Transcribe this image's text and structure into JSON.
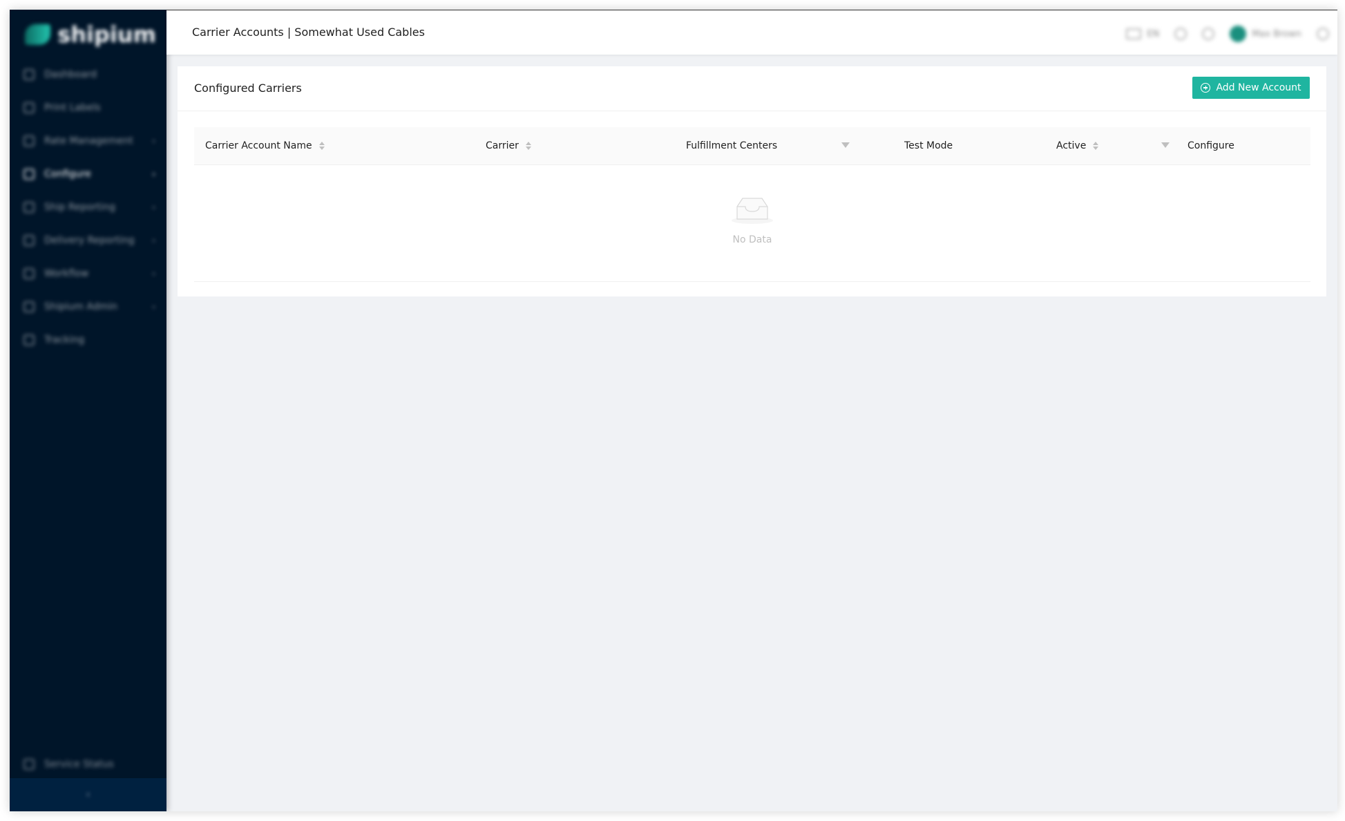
{
  "sidebar": {
    "logo_text": "shipium",
    "items": [
      {
        "label": "Dashboard",
        "icon": "dashboard-icon",
        "caret": ""
      },
      {
        "label": "Print Labels",
        "icon": "printer-icon",
        "caret": ""
      },
      {
        "label": "Rate Management",
        "icon": "tag-icon",
        "caret": "›"
      },
      {
        "label": "Configure",
        "icon": "settings-icon",
        "caret": "›"
      },
      {
        "label": "Ship Reporting",
        "icon": "report-icon",
        "caret": "›"
      },
      {
        "label": "Delivery Reporting",
        "icon": "chart-icon",
        "caret": "›"
      },
      {
        "label": "Workflow",
        "icon": "workflow-icon",
        "caret": "›"
      },
      {
        "label": "Shipium Admin",
        "icon": "admin-icon",
        "caret": "›"
      },
      {
        "label": "Tracking",
        "icon": "tracking-icon",
        "caret": ""
      }
    ],
    "bottom_item": "Service Status",
    "collapse_label": "‹"
  },
  "header": {
    "title": "Carrier Accounts | Somewhat Used Cables",
    "lang": "EN",
    "user_name": "Max Brown"
  },
  "card": {
    "title": "Configured Carriers",
    "add_button_label": "Add New Account"
  },
  "table": {
    "columns": {
      "carrier_account_name": "Carrier Account Name",
      "carrier": "Carrier",
      "fulfillment_centers": "Fulfillment Centers",
      "test_mode": "Test Mode",
      "active": "Active",
      "configure": "Configure"
    },
    "empty_text": "No Data"
  },
  "colors": {
    "sidebar_bg": "#001529",
    "accent": "#1fb5a0",
    "content_bg": "#f0f2f5"
  }
}
